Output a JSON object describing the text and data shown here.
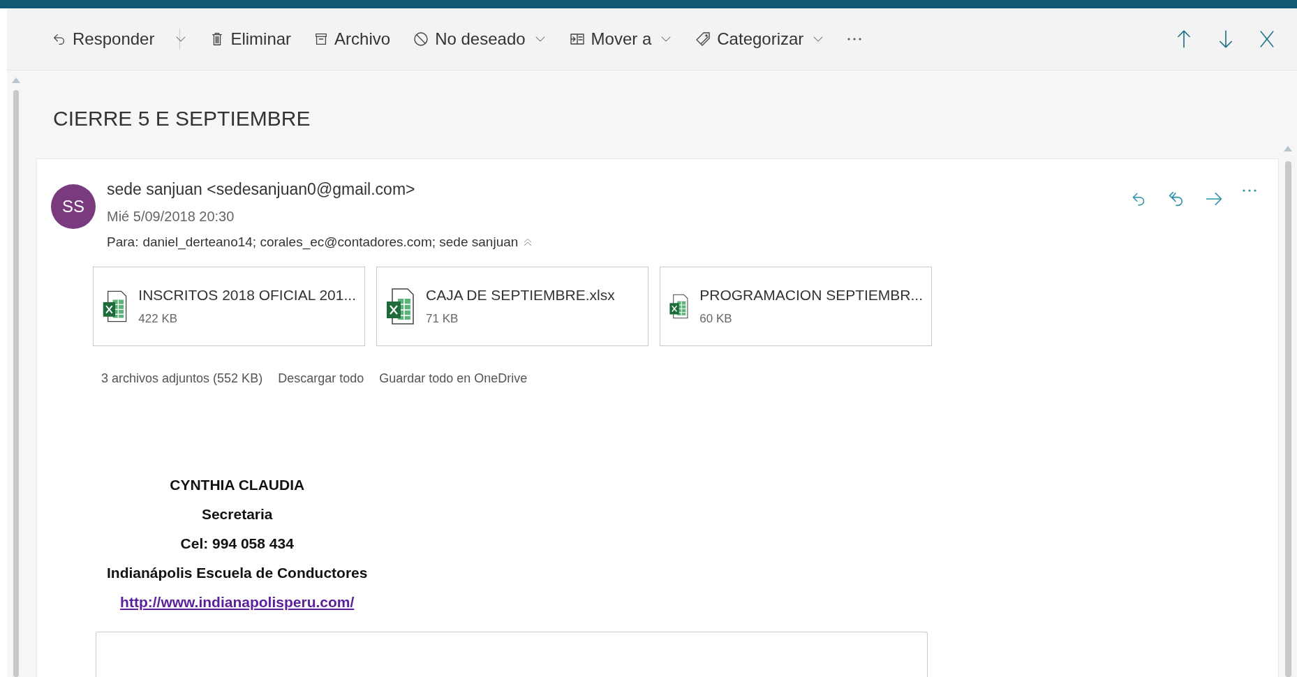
{
  "toolbar": {
    "items": [
      {
        "kind": "reply",
        "label": "Responder",
        "dropdown": true,
        "split": true
      },
      {
        "kind": "delete",
        "label": "Eliminar",
        "dropdown": false,
        "split": false
      },
      {
        "kind": "archive",
        "label": "Archivo",
        "dropdown": false,
        "split": false
      },
      {
        "kind": "junk",
        "label": "No deseado",
        "dropdown": true,
        "split": false
      },
      {
        "kind": "move",
        "label": "Mover a",
        "dropdown": true,
        "split": false
      },
      {
        "kind": "categorize",
        "label": "Categorizar",
        "dropdown": true,
        "split": false
      }
    ]
  },
  "subject": "CIERRE 5 E SEPTIEMBRE",
  "message": {
    "avatar": "SS",
    "sender": "sede sanjuan <sedesanjuan0@gmail.com>",
    "date": "Mié 5/09/2018 20:30",
    "to_label": "Para:",
    "to": "daniel_derteano14; corales_ec@contadores.com; sede sanjuan",
    "attachments": [
      {
        "name": "INSCRITOS 2018 OFICIAL 201...",
        "size": "422 KB"
      },
      {
        "name": "CAJA DE SEPTIEMBRE.xlsx",
        "size": "71 KB"
      },
      {
        "name": "PROGRAMACION SEPTIEMBR...",
        "size": "60 KB"
      }
    ],
    "attachments_summary": "3 archivos adjuntos (552 KB)",
    "attachment_actions": [
      "Descargar todo",
      "Guardar todo en OneDrive"
    ],
    "signature": [
      "CYNTHIA CLAUDIA",
      "Secretaria",
      "Cel: 994 058 434",
      "Indianápolis Escuela de Conductores"
    ],
    "link": "http://www.indianapolisperu.com/"
  }
}
